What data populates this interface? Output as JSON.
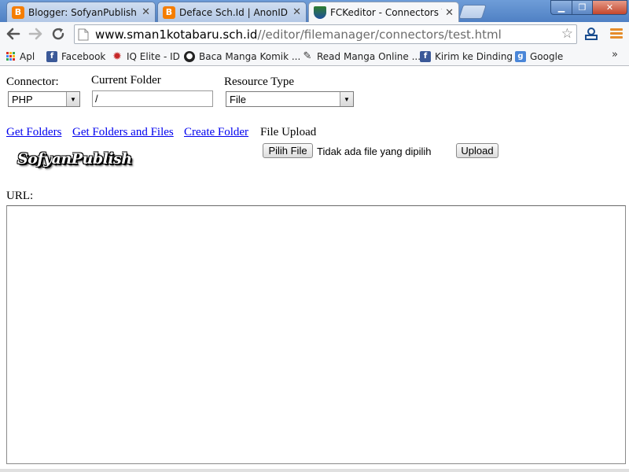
{
  "browser": {
    "tabs": [
      {
        "title": "Blogger: SofyanPublish - C",
        "favicon": "blogger-icon",
        "active": false
      },
      {
        "title": "Deface Sch.Id | AnonID",
        "favicon": "blogger-icon",
        "active": false
      },
      {
        "title": "FCKeditor - Connectors Te",
        "favicon": "school-crest-icon",
        "active": true
      }
    ],
    "address": {
      "host": "www.sman1kotabaru.sch.id",
      "path": "//editor/filemanager/connectors/test.html"
    },
    "bookmarks": [
      {
        "label": "Apl",
        "icon": "apps-grid-icon"
      },
      {
        "label": "Facebook",
        "icon": "facebook-icon"
      },
      {
        "label": "IQ Elite - ID",
        "icon": "gear-icon"
      },
      {
        "label": "Baca Manga Komik ...",
        "icon": "manga-icon"
      },
      {
        "label": "Read Manga Online ...",
        "icon": "read-manga-icon"
      },
      {
        "label": "Kirim ke Dinding",
        "icon": "facebook-icon"
      },
      {
        "label": "Google",
        "icon": "google-icon"
      }
    ],
    "bookmarks_more": "»",
    "colors": {
      "tab_strip": "#5b8bd0",
      "toolbar": "#f6f7f9",
      "link": "#0000ee"
    }
  },
  "page": {
    "connector": {
      "label": "Connector:",
      "value": "PHP"
    },
    "current_folder": {
      "label": "Current Folder",
      "value": "/"
    },
    "resource_type": {
      "label": "Resource Type",
      "value": "File"
    },
    "links": {
      "get_folders": "Get Folders",
      "get_folders_and_files": "Get Folders and Files",
      "create_folder": "Create Folder"
    },
    "file_upload": {
      "label": "File Upload",
      "choose_button": "Pilih File",
      "status": "Tidak ada file yang dipilih",
      "upload_button": "Upload"
    },
    "logo_text": "SofyanPublish",
    "url_label": "URL:"
  }
}
